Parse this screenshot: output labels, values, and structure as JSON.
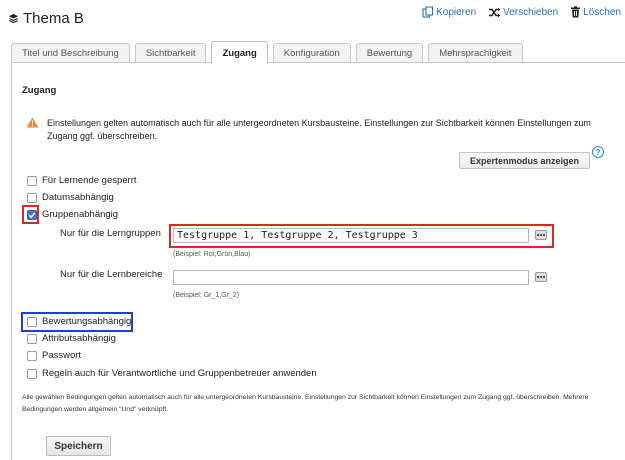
{
  "header": {
    "title": "Thema B",
    "title_icon": "stack-icon",
    "actions": [
      {
        "label": "Kopieren",
        "icon": "copy-icon"
      },
      {
        "label": "Verschieben",
        "icon": "shuffle-icon"
      },
      {
        "label": "Löschen",
        "icon": "trash-icon"
      }
    ]
  },
  "tabs": [
    {
      "label": "Titel und Beschreibung",
      "active": false
    },
    {
      "label": "Sichtbarkeit",
      "active": false
    },
    {
      "label": "Zugang",
      "active": true
    },
    {
      "label": "Konfiguration",
      "active": false
    },
    {
      "label": "Bewertung",
      "active": false
    },
    {
      "label": "Mehrsprachigkeit",
      "active": false
    }
  ],
  "section": {
    "title": "Zugang",
    "warning_icon": "warning-icon",
    "warning": "Einstellungen gelten automatisch auch für alle untergeordneten Kursbausteine. Einstellungen zur Sichtbarkeit können Einstellungen zum Zugang ggf. überschreiben."
  },
  "expert_mode": {
    "label": "Expertenmodus anzeigen",
    "help_icon": "?"
  },
  "conditions": [
    {
      "label": "Für Lernende gesperrt",
      "checked": false
    },
    {
      "label": "Datumsabhängig",
      "checked": false
    },
    {
      "label": "Gruppenabhängig",
      "checked": true
    },
    {
      "label": "Bewertungsabhängig",
      "checked": false
    },
    {
      "label": "Attributsabhängig",
      "checked": false
    },
    {
      "label": "Passwort",
      "checked": false
    },
    {
      "label": "Regeln auch für Verantwortliche und Gruppenbetreuer anwenden",
      "checked": false
    }
  ],
  "groups": {
    "label": "Nur für die Lerngruppen",
    "value": "Testgruppe 1, Testgruppe 2, Testgruppe 3",
    "hint": "(Beispiel: Rot,Grün,Blau)"
  },
  "areas": {
    "label": "Nur für die Lernbereiche",
    "value": "",
    "hint": "(Beispiel: Gr_1,Gr_2)"
  },
  "footer_note": "Alle gewählen Bedingungen gelten automatisch auch für alle untergeordneten Kursbausteine. Einstellungen zur Sichtbarkeit können Einstellungen zum Zugang ggf. überschreiben. Mehrere Bedingungen werden allgemein \"Und\" verknüpft.",
  "save_label": "Speichern",
  "highlight_colors": {
    "red": "#e0261f",
    "blue": "#1c3fcf"
  }
}
